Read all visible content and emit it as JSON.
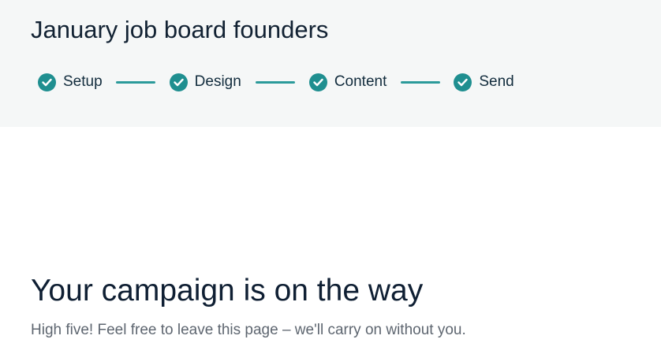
{
  "header": {
    "campaign_title": "January job board founders"
  },
  "steps": [
    {
      "label": "Setup",
      "status": "complete",
      "icon": "check-circle-icon"
    },
    {
      "label": "Design",
      "status": "complete",
      "icon": "check-circle-icon"
    },
    {
      "label": "Content",
      "status": "complete",
      "icon": "check-circle-icon"
    },
    {
      "label": "Send",
      "status": "complete",
      "icon": "check-circle-icon"
    }
  ],
  "main": {
    "heading": "Your campaign is on the way",
    "subtext": "High five! Feel free to leave this page – we'll carry on without you."
  },
  "colors": {
    "accent": "#1f8f90",
    "header_background": "#f5f7f7",
    "heading_text": "#0f1f33",
    "muted_text": "#5e6670"
  }
}
